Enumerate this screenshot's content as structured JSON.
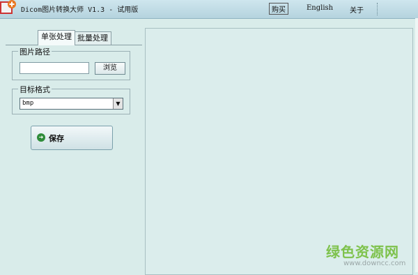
{
  "window": {
    "title": "Dicom图片转换大师 V1.3 - 试用版",
    "menu": {
      "buy": "购买",
      "english": "English",
      "about": "关于"
    }
  },
  "tabs": {
    "single": "单张处理",
    "batch": "批量处理"
  },
  "path_group": {
    "label": "图片路径",
    "value": "",
    "browse_label": "浏览"
  },
  "format_group": {
    "label": "目标格式",
    "selected": "bmp"
  },
  "save_label": "保存",
  "icons": {
    "app": "app-plus-icon",
    "save": "arrow-right-circle-icon",
    "dropdown": "triangle-down-icon"
  },
  "colors": {
    "background": "#d9ecea",
    "title_bar": "#b5d3de",
    "save_icon": "#2f8c3a"
  },
  "watermark": {
    "text": "绿色资源网",
    "url": "www.downcc.com"
  }
}
